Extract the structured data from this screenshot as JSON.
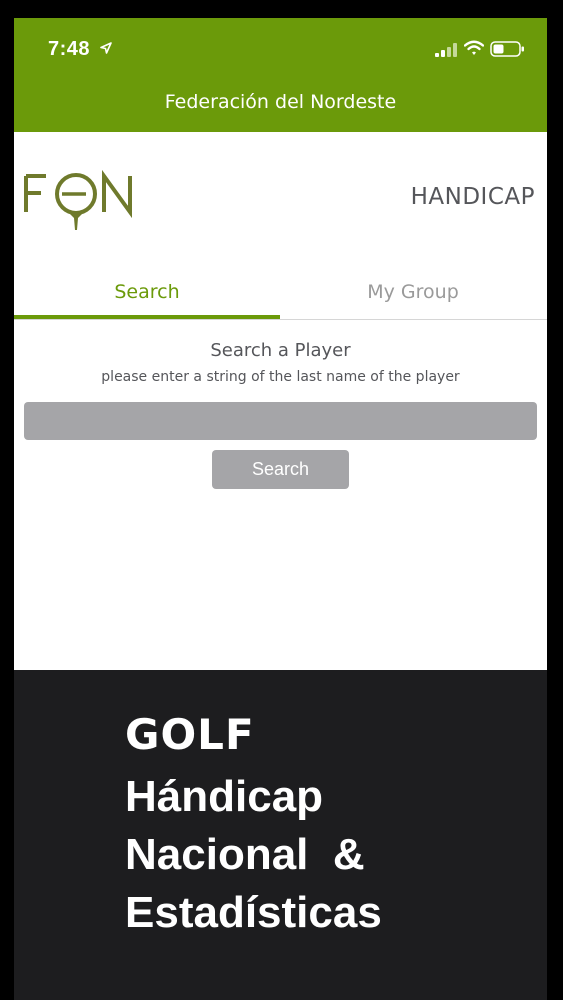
{
  "status_bar": {
    "time": "7:48",
    "icons": [
      "location-arrow-icon",
      "cellular-signal-icon",
      "wifi-icon",
      "battery-icon"
    ]
  },
  "nav": {
    "title": "Federación del Nordeste"
  },
  "header": {
    "logo_text": "FGN",
    "section_title": "HANDICAP"
  },
  "tabs": [
    {
      "label": "Search",
      "active": true
    },
    {
      "label": "My Group",
      "active": false
    }
  ],
  "search": {
    "heading": "Search a Player",
    "hint": "please enter a string of the last name of the player",
    "input_value": "",
    "button_label": "Search"
  },
  "promo": {
    "line1": "GOLF",
    "line2": "Hándicap",
    "line3": "Nacional  &",
    "line4": "Estadísticas"
  },
  "colors": {
    "brand_green": "#6b9a0a",
    "logo_olive": "#6f7a2c",
    "input_gray": "#a5a5a8",
    "promo_bg": "#1d1d1f"
  }
}
